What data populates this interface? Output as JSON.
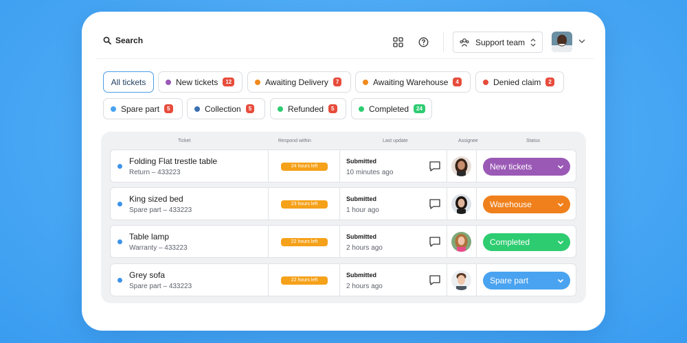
{
  "header": {
    "search_label": "Search",
    "team_label": "Support team"
  },
  "filters": [
    {
      "label": "All tickets",
      "active": true
    },
    {
      "label": "New tickets",
      "count": "12",
      "dot": "#9b59b6"
    },
    {
      "label": "Awaiting Delivery",
      "count": "7",
      "dot": "#f08a1c"
    },
    {
      "label": "Awaiting Warehouse",
      "count": "4",
      "dot": "#f08a1c"
    },
    {
      "label": "Denied claim",
      "count": "2",
      "dot": "#e74c3c"
    },
    {
      "label": "Spare part",
      "count": "5",
      "dot": "#4aa3f0"
    },
    {
      "label": "Collection",
      "count": "5",
      "dot": "#3a6fb0"
    },
    {
      "label": "Refunded",
      "count": "5",
      "dot": "#2ecc71"
    },
    {
      "label": "Completed",
      "count": "24",
      "dot": "#2ecc71",
      "count_color": "#2ecc71"
    }
  ],
  "table": {
    "headers": [
      "Ticket",
      "Respond within",
      "Last update",
      "Assignee",
      "Status"
    ],
    "rows": [
      {
        "title": "Folding Flat trestle table",
        "sub": "Return – 433223",
        "respond": "24 hours left",
        "update_title": "Submitted",
        "update_time": "10 minutes ago",
        "status": "New tickets",
        "status_color": "#9b59b6"
      },
      {
        "title": "King sized bed",
        "sub": "Spare part – 433223",
        "respond": "23 hours left",
        "update_title": "Submitted",
        "update_time": "1 hour ago",
        "status": "Warehouse",
        "status_color": "#f0801c"
      },
      {
        "title": "Table lamp",
        "sub": "Warranty – 433223",
        "respond": "22 hours left",
        "update_title": "Submitted",
        "update_time": "2 hours ago",
        "status": "Completed",
        "status_color": "#2ecc71"
      },
      {
        "title": "Grey sofa",
        "sub": "Spare part – 433223",
        "respond": "22 hours left",
        "update_title": "Submitted",
        "update_time": "2 hours ago",
        "status": "Spare part",
        "status_color": "#4aa3f0"
      }
    ]
  },
  "colors": {
    "accent": "#4a9be6",
    "badge_red": "#e74c3c",
    "badge_orange": "#f5a11a"
  },
  "icons": [
    "search-icon",
    "grid-icon",
    "help-icon",
    "team-icon",
    "chevron-updown-icon",
    "chevron-down-icon",
    "comment-icon"
  ]
}
